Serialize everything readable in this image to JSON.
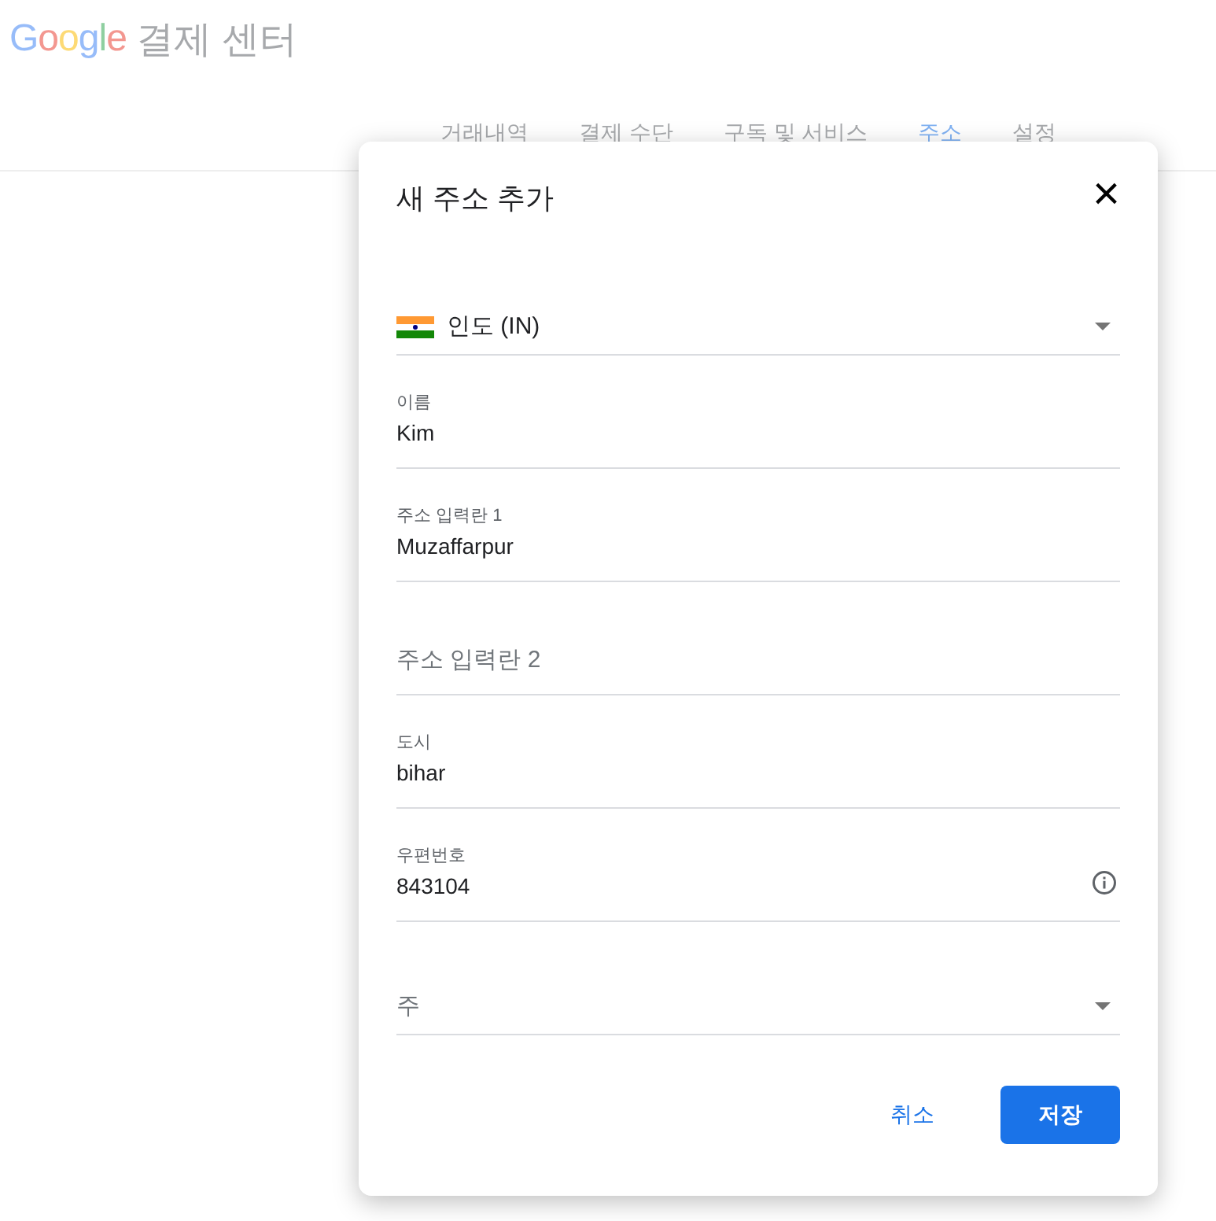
{
  "header": {
    "logo": "Google",
    "title": "결제 센터"
  },
  "tabs": [
    {
      "label": "거래내역",
      "selected": false
    },
    {
      "label": "결제 수단",
      "selected": false
    },
    {
      "label": "구독 및 서비스",
      "selected": false
    },
    {
      "label": "주소",
      "selected": true
    },
    {
      "label": "설정",
      "selected": false
    }
  ],
  "dialog": {
    "title": "새 주소 추가",
    "close": "×",
    "fields": [
      {
        "kind": "country",
        "value": "인도 (IN)"
      },
      {
        "kind": "text",
        "label": "이름",
        "value": "Kim",
        "info": false
      },
      {
        "kind": "text",
        "label": "주소 입력란 1",
        "value": "Muzaffarpur",
        "info": false
      },
      {
        "kind": "text",
        "placeholder": "주소 입력란 2",
        "info": false
      },
      {
        "kind": "text",
        "label": "도시",
        "value": "bihar",
        "info": false
      },
      {
        "kind": "text",
        "label": "우편번호",
        "value": "843104",
        "info": true
      },
      {
        "kind": "select",
        "placeholder": "주"
      }
    ],
    "buttons": [
      {
        "kind": "text",
        "label": "취소"
      },
      {
        "kind": "primary",
        "label": "저장"
      }
    ]
  }
}
